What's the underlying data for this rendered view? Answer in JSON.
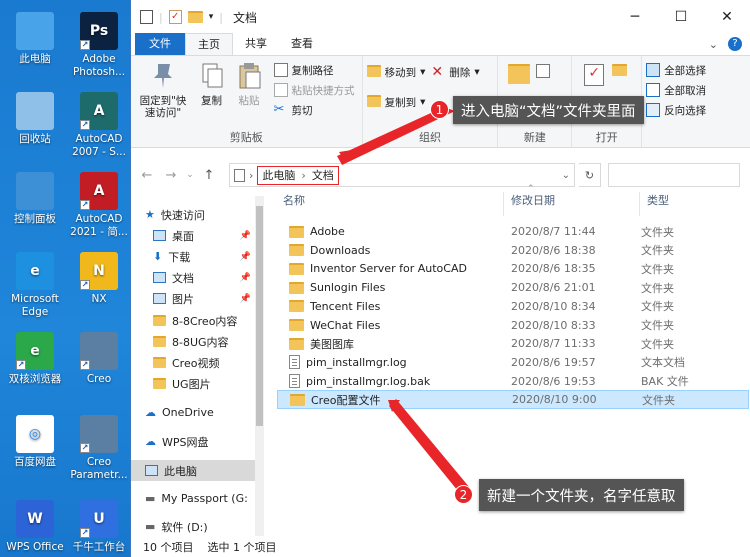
{
  "desktop": {
    "icons": [
      {
        "label": "此电脑",
        "icon": "computer-icon",
        "color": "#49a3e8"
      },
      {
        "label": "Adobe Photosh...",
        "icon": "photoshop-icon",
        "color": "#0b2340",
        "text": "Ps"
      },
      {
        "label": "回收站",
        "icon": "recycle-bin-icon",
        "color": "#8fc0e8"
      },
      {
        "label": "AutoCAD 2007 - S...",
        "icon": "autocad-icon",
        "color": "#1e6b6b",
        "text": "A"
      },
      {
        "label": "控制面板",
        "icon": "control-panel-icon",
        "color": "#3d8fd6"
      },
      {
        "label": "AutoCAD 2021 - 简...",
        "icon": "autocad-icon",
        "color": "#c21d24",
        "text": "A"
      },
      {
        "label": "Microsoft Edge",
        "icon": "edge-icon",
        "color": "#1e90e0",
        "text": "e"
      },
      {
        "label": "NX",
        "icon": "nx-icon",
        "color": "#f0b81a",
        "text": "N"
      },
      {
        "label": "双核浏览器",
        "icon": "browser-icon",
        "color": "#2aa84a",
        "text": "e"
      },
      {
        "label": "Creo",
        "icon": "creo-icon",
        "color": "#5b7fa3"
      },
      {
        "label": "百度网盘",
        "icon": "baidu-netdisk-icon",
        "color": "#ffffff"
      },
      {
        "label": "Creo Parametr...",
        "icon": "creo-parametric-icon",
        "color": "#5b7fa3"
      },
      {
        "label": "WPS Office",
        "icon": "wps-icon",
        "color": "#2c63d6",
        "text": "W"
      },
      {
        "label": "千牛工作台",
        "icon": "qianniu-icon",
        "color": "#2f6fe0",
        "text": "U"
      }
    ]
  },
  "window": {
    "title": "文档",
    "controls": {
      "minimize": "─",
      "maximize": "☐",
      "close": "✕"
    },
    "tabs": [
      "文件",
      "主页",
      "共享",
      "查看"
    ],
    "ribbon": {
      "clipboard": {
        "pin": "固定到\"快速访问\"",
        "copy": "复制",
        "paste": "粘贴",
        "copy_path": "复制路径",
        "paste_shortcut": "粘贴快捷方式",
        "cut": "剪切",
        "label": "剪贴板"
      },
      "organize": {
        "move_to": "移动到",
        "copy_to": "复制到",
        "delete": "删除",
        "rename": "重命名",
        "label": "组织"
      },
      "new": {
        "label": "新建"
      },
      "open": {
        "label": "打开"
      },
      "select": {
        "all": "全部选择",
        "none": "全部取消",
        "invert": "反向选择"
      }
    },
    "address": {
      "crumbs": [
        "此电脑",
        "文档"
      ],
      "separator": "›"
    },
    "columns": {
      "name": "名称",
      "date": "修改日期",
      "type": "类型"
    },
    "nav": [
      {
        "label": "快速访问",
        "icon": "star-icon",
        "pin": false
      },
      {
        "label": "桌面",
        "icon": "desktop-icon",
        "pin": true
      },
      {
        "label": "下载",
        "icon": "download-icon",
        "pin": true
      },
      {
        "label": "文档",
        "icon": "documents-icon",
        "pin": true
      },
      {
        "label": "图片",
        "icon": "pictures-icon",
        "pin": true
      },
      {
        "label": "8-8Creo内容",
        "icon": "folder-icon",
        "pin": false
      },
      {
        "label": "8-8UG内容",
        "icon": "folder-icon",
        "pin": false
      },
      {
        "label": "Creo视频",
        "icon": "folder-icon",
        "pin": false
      },
      {
        "label": "UG图片",
        "icon": "folder-icon",
        "pin": false
      },
      {
        "label": "OneDrive",
        "icon": "cloud-icon",
        "pin": false
      },
      {
        "label": "WPS网盘",
        "icon": "cloud-icon",
        "pin": false
      },
      {
        "label": "此电脑",
        "icon": "computer-icon",
        "pin": false
      },
      {
        "label": "My Passport (G:",
        "icon": "drive-icon",
        "pin": false
      },
      {
        "label": "软件 (D:)",
        "icon": "drive-icon",
        "pin": false
      }
    ],
    "files": [
      {
        "name": "Adobe",
        "date": "2020/8/7 11:44",
        "type": "文件夹",
        "kind": "folder"
      },
      {
        "name": "Downloads",
        "date": "2020/8/6 18:38",
        "type": "文件夹",
        "kind": "folder"
      },
      {
        "name": "Inventor Server for AutoCAD",
        "date": "2020/8/6 18:35",
        "type": "文件夹",
        "kind": "folder"
      },
      {
        "name": "Sunlogin Files",
        "date": "2020/8/6 21:01",
        "type": "文件夹",
        "kind": "folder"
      },
      {
        "name": "Tencent Files",
        "date": "2020/8/10 8:34",
        "type": "文件夹",
        "kind": "folder"
      },
      {
        "name": "WeChat Files",
        "date": "2020/8/10 8:33",
        "type": "文件夹",
        "kind": "folder"
      },
      {
        "name": "美图图库",
        "date": "2020/8/7 11:33",
        "type": "文件夹",
        "kind": "folder"
      },
      {
        "name": "pim_installmgr.log",
        "date": "2020/8/6 19:57",
        "type": "文本文档",
        "kind": "doc"
      },
      {
        "name": "pim_installmgr.log.bak",
        "date": "2020/8/6 19:53",
        "type": "BAK 文件",
        "kind": "doc"
      },
      {
        "name": "Creo配置文件",
        "date": "2020/8/10 9:00",
        "type": "文件夹",
        "kind": "folder",
        "selected": true
      }
    ],
    "status": {
      "count": "10 个项目",
      "selected": "选中 1 个项目"
    }
  },
  "annotations": [
    {
      "number": "1",
      "text": "进入电脑“文档”文件夹里面"
    },
    {
      "number": "2",
      "text": "新建一个文件夹，名字任意取"
    }
  ],
  "colors": {
    "accent": "#1a6fc9",
    "highlight": "#e8262a",
    "selection": "#cce8ff"
  }
}
